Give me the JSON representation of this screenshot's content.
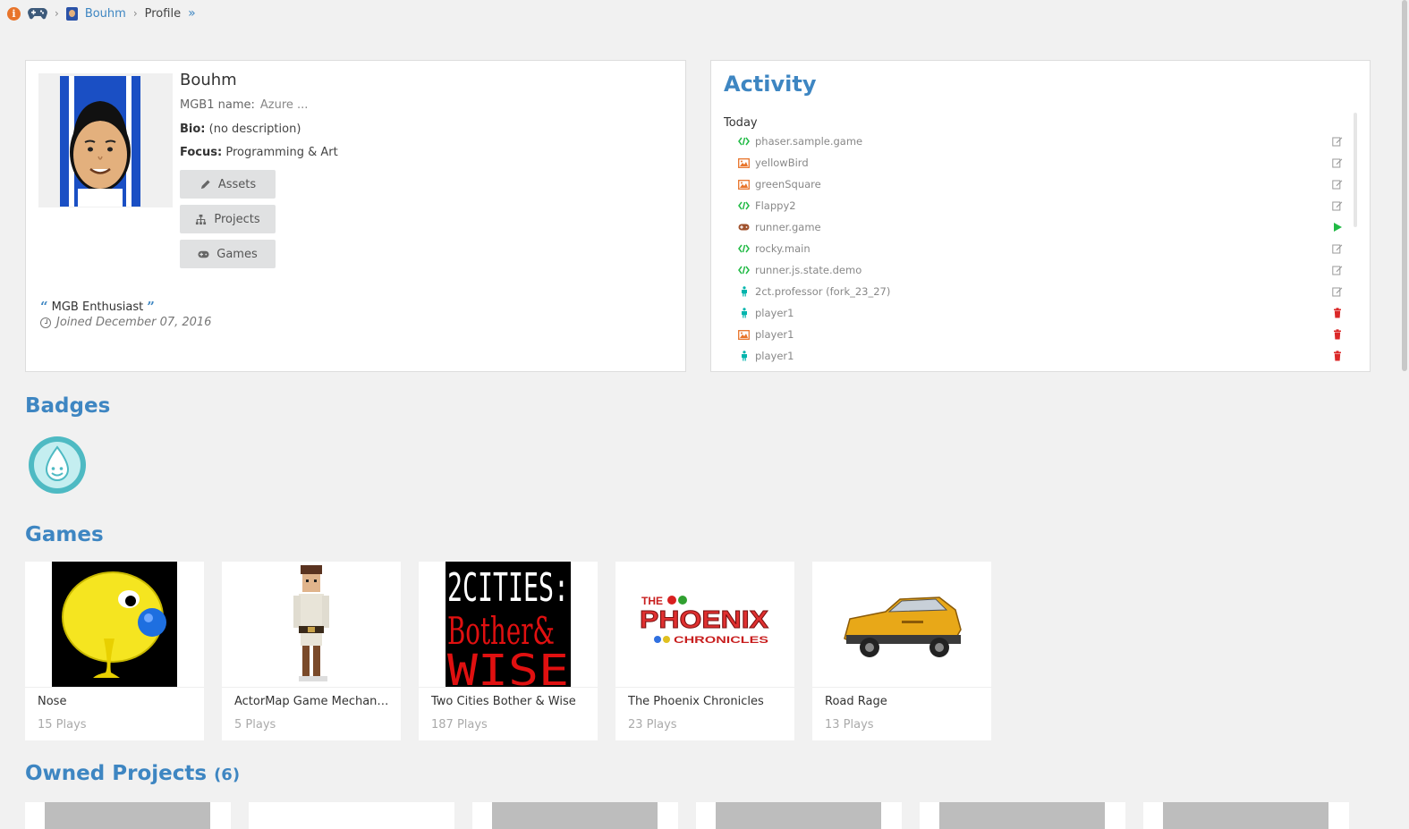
{
  "breadcrumb": {
    "user": "Bouhm",
    "current": "Profile",
    "more": "»"
  },
  "profile": {
    "name": "Bouhm",
    "mgb1_label": "MGB1 name:",
    "mgb1_value": "Azure ...",
    "bio_label": "Bio:",
    "bio_value": "(no description)",
    "focus_label": "Focus:",
    "focus_value": "Programming & Art",
    "buttons": {
      "assets": "Assets",
      "projects": "Projects",
      "games": "Games"
    },
    "enthusiast": "MGB Enthusiast",
    "joined": "Joined December 07, 2016"
  },
  "activity": {
    "title": "Activity",
    "group": "Today",
    "items": [
      {
        "name": "phaser.sample.game",
        "icon": "code-icon",
        "action": "edit-icon"
      },
      {
        "name": "yellowBird",
        "icon": "image-icon",
        "action": "edit-icon"
      },
      {
        "name": "greenSquare",
        "icon": "image-icon",
        "action": "edit-icon"
      },
      {
        "name": "Flappy2",
        "icon": "code-icon",
        "action": "edit-icon"
      },
      {
        "name": "runner.game",
        "icon": "gamepad-icon",
        "action": "play-icon"
      },
      {
        "name": "rocky.main",
        "icon": "code-icon",
        "action": "edit-icon"
      },
      {
        "name": "runner.js.state.demo",
        "icon": "code-icon",
        "action": "edit-icon"
      },
      {
        "name": "2ct.professor (fork_23_27)",
        "icon": "actor-icon",
        "action": "edit-icon"
      },
      {
        "name": "player1",
        "icon": "actor-icon",
        "action": "trash-icon"
      },
      {
        "name": "player1",
        "icon": "image-icon",
        "action": "trash-icon"
      },
      {
        "name": "player1",
        "icon": "actor-icon",
        "action": "trash-icon"
      }
    ],
    "colors": {
      "code": "#21ba45",
      "image": "#e8742a",
      "gamepad": "#a0522d",
      "actor": "#00b5ad",
      "play": "#21ba45",
      "trash": "#db2828",
      "edit": "#999999"
    }
  },
  "badges": {
    "title": "Badges"
  },
  "games": {
    "title": "Games",
    "items": [
      {
        "title": "Nose",
        "plays": "15 Plays"
      },
      {
        "title": "ActorMap Game Mechanic...",
        "plays": "5 Plays"
      },
      {
        "title": "Two Cities Bother & Wise",
        "plays": "187 Plays"
      },
      {
        "title": "The Phoenix Chronicles",
        "plays": "23 Plays"
      },
      {
        "title": "Road Rage",
        "plays": "13 Plays"
      }
    ]
  },
  "projects": {
    "title": "Owned Projects",
    "count": "(6)"
  },
  "thumbs": {
    "cities_line1": "2CITIES:",
    "cities_line2": "Bother&",
    "cities_line3": "WISE",
    "phoenix_the": "THE",
    "phoenix_main": "PHOENIX",
    "phoenix_sub": "CHRONICLES"
  },
  "theme": {
    "accent": "#3e86c2",
    "background": "#f1f1f1"
  }
}
